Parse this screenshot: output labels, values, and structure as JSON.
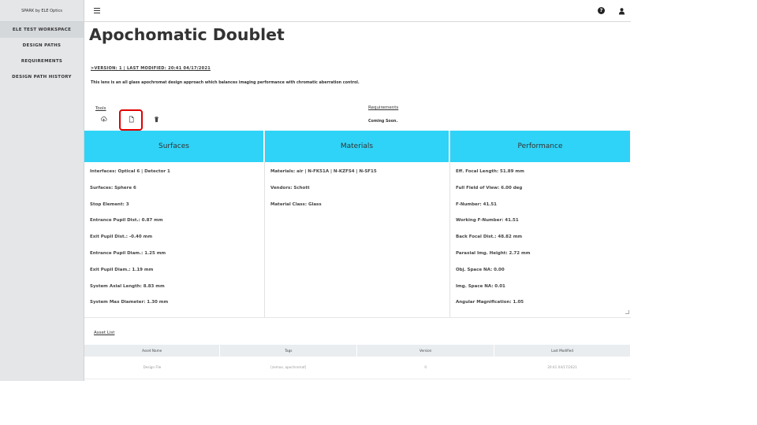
{
  "sidebar": {
    "brand": "SPARK by ELE Optics",
    "items": [
      {
        "label": "ELE TEST WORKSPACE"
      },
      {
        "label": "DESIGN PATHS"
      },
      {
        "label": "REQUIREMENTS"
      },
      {
        "label": "DESIGN PATH HISTORY"
      }
    ]
  },
  "header": {
    "icons": [
      "hamburger-menu-icon",
      "help-icon",
      "user-icon"
    ],
    "help_glyph": "?"
  },
  "main": {
    "title": "Apochomatic Doublet",
    "version_line": ">VERSION: 1 | LAST MODIFIED: 20:41 04/17/2021",
    "description": "This lens is an all glass apochromat design approach which balances imaging performance with chromatic aberration control.",
    "tools_label": "Tools",
    "tools": [
      "upload-icon",
      "file-icon",
      "trash-icon"
    ],
    "requirements_label": "Requirements",
    "requirements_value": "Coming Soon."
  },
  "panels": {
    "surfaces": {
      "title": "Surfaces",
      "rows": [
        "Interfaces: Optical 6 | Detector 1",
        "Surfaces: Sphere 6",
        "Stop Element: 3",
        "Entrance Pupil Dist.: 0.87 mm",
        "Exit Pupil Dist.: -0.40 mm",
        "Entrance Pupil Diam.: 1.25 mm",
        "Exit Pupil Diam.: 1.19 mm",
        "System Axial Length: 8.83 mm",
        "System Max Diameter: 1.30 mm"
      ]
    },
    "materials": {
      "title": "Materials",
      "rows": [
        "Materials: air | N-FK51A | N-KZFS4 | N-SF15",
        "Vendors: Schott",
        "Material Class: Glass"
      ]
    },
    "performance": {
      "title": "Performance",
      "rows": [
        "Eff. Focal Length: 51.89 mm",
        "Full Field of View: 6.00 deg",
        "F-Number: 41.51",
        "Working F-Number: 41.51",
        "Back Focal Dist.: 48.82 mm",
        "Paraxial Img. Height: 2.72 mm",
        "Obj. Space NA: 0.00",
        "Img. Space NA: 0.01",
        "Angular Magnification: 1.05"
      ]
    }
  },
  "assets": {
    "label": "Asset List",
    "columns": [
      "Asset Name",
      "Tags",
      "Version",
      "Last Modified"
    ],
    "rows": [
      [
        "Design File",
        "[zemax, apochromat]",
        "0",
        "20:41 04/17/2021"
      ]
    ]
  },
  "colors": {
    "panel_header": "#2fd3f7",
    "highlight": "#e00000",
    "sidebar_bg": "#e4e6e8"
  }
}
